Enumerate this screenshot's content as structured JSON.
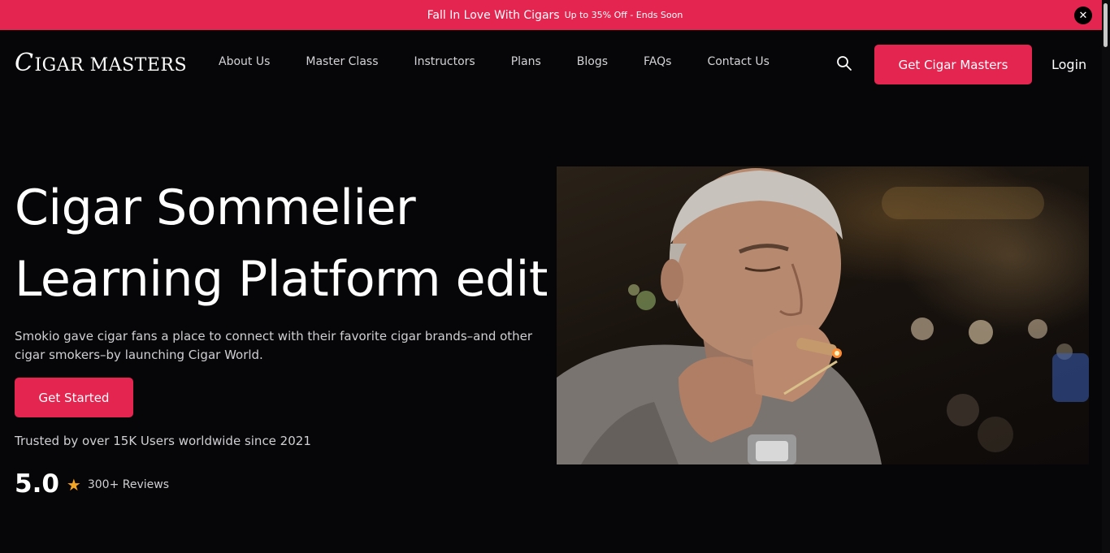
{
  "announcement": {
    "main_text": "Fall In Love With Cigars",
    "sub_text": "Up to 35% Off - Ends Soon",
    "close_icon": "close-icon"
  },
  "header": {
    "logo_text": "CIGAR MASTERS",
    "nav": [
      "About Us",
      "Master Class",
      "Instructors",
      "Plans",
      "Blogs",
      "FAQs",
      "Contact Us"
    ],
    "search_icon": "search-icon",
    "cta_label": "Get Cigar Masters",
    "login_label": "Login"
  },
  "hero": {
    "title_line1": "Cigar Sommelier",
    "title_line2": "Learning Platform edit",
    "description": "Smokio gave cigar fans a place to connect with their favorite cigar brands–and other cigar smokers–by launching Cigar World.",
    "button_label": "Get Started",
    "trust_text": "Trusted by over 15K Users worldwide since 2021",
    "rating_score": "5.0",
    "rating_icon": "star-icon",
    "reviews_text": "300+ Reviews"
  },
  "colors": {
    "accent": "#e42550",
    "background": "#060507",
    "star": "#f5a524"
  }
}
